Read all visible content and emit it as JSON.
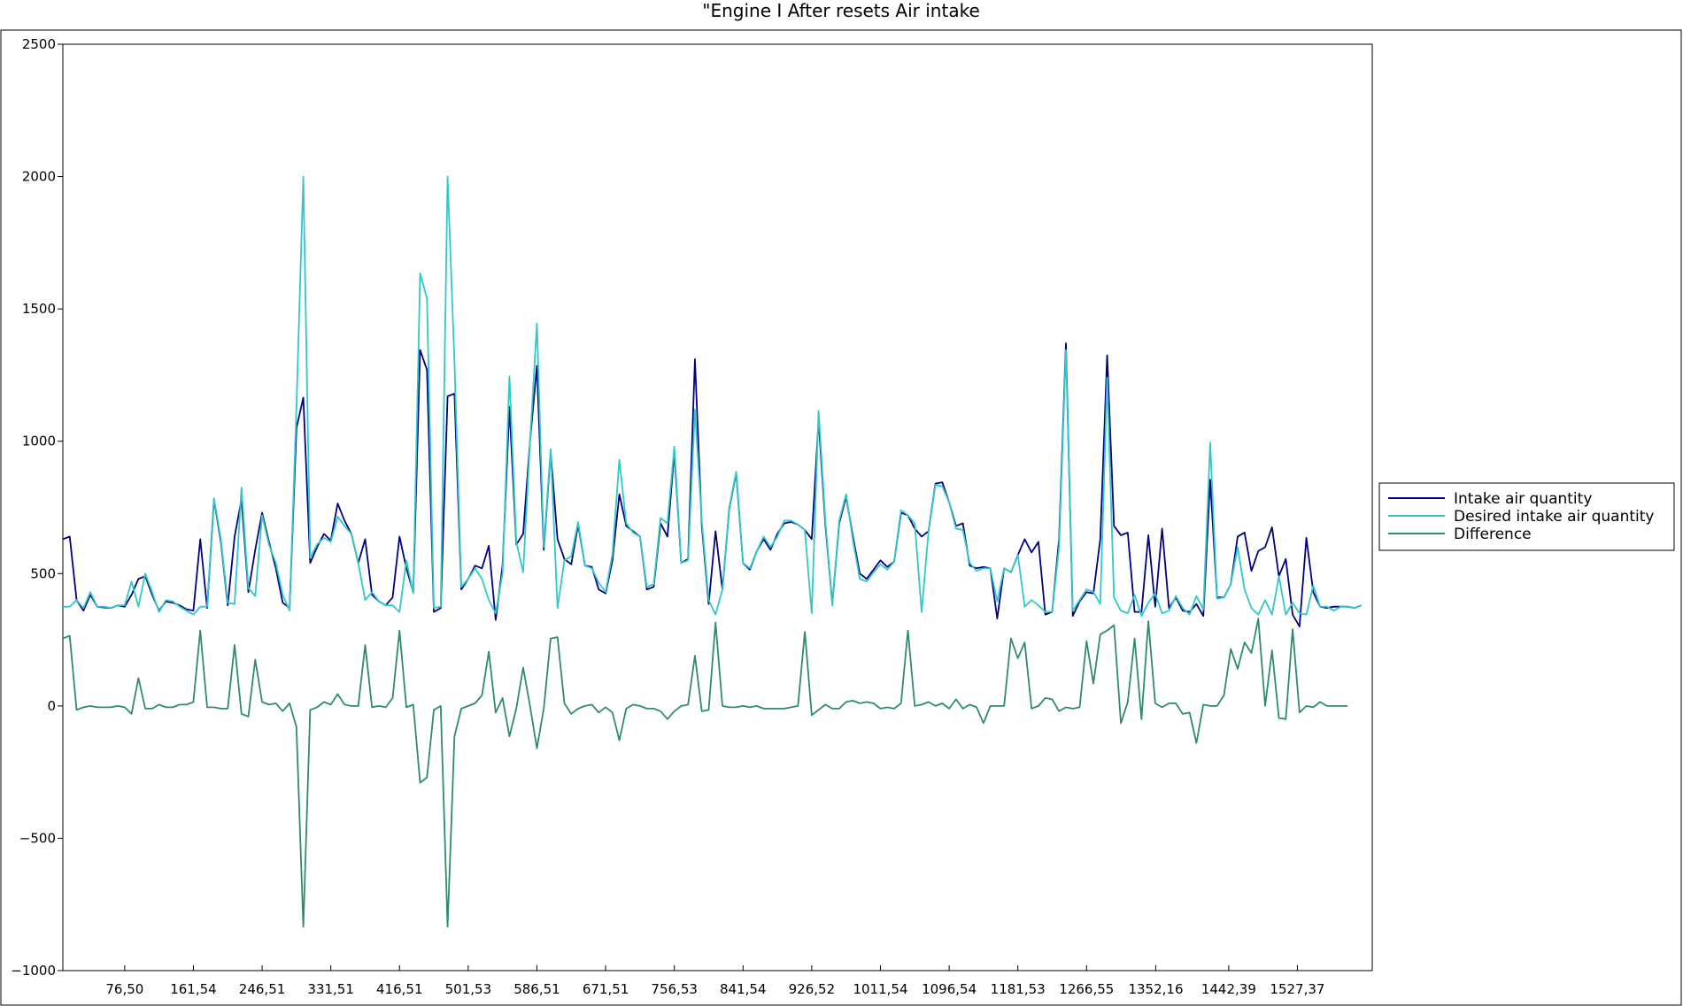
{
  "chart_data": {
    "type": "line",
    "title": "\"Engine I After resets Air intake",
    "xlabel": "",
    "ylabel": "",
    "ylim": [
      -1000,
      2500
    ],
    "yticks": [
      -1000,
      -500,
      0,
      500,
      1000,
      1500,
      2000,
      2500
    ],
    "ytick_labels": [
      "−1000",
      "−500",
      "0",
      "500",
      "1000",
      "1500",
      "2000",
      "2500"
    ],
    "xlim": [
      0,
      1620
    ],
    "xticks": [
      76.5,
      161.54,
      246.51,
      331.51,
      416.51,
      501.53,
      586.51,
      671.51,
      756.53,
      841.54,
      926.52,
      1011.54,
      1096.54,
      1181.53,
      1266.55,
      1352.16,
      1442.39,
      1527.37
    ],
    "xtick_labels": [
      "76,50",
      "161,54",
      "246,51",
      "331,51",
      "416,51",
      "501,53",
      "586,51",
      "671,51",
      "756,53",
      "841,54",
      "926,52",
      "1011,54",
      "1096,54",
      "1181,53",
      "1266,55",
      "1352,16",
      "1442,39",
      "1527,37"
    ],
    "grid": false,
    "legend_position": "right",
    "x": [
      0,
      8.5,
      17,
      25.5,
      34,
      42.5,
      51,
      59.5,
      68,
      76.5,
      85,
      93.5,
      102,
      110.5,
      119,
      127.5,
      136,
      144.5,
      153,
      161.5,
      170,
      178.5,
      187,
      195.5,
      204,
      212.5,
      221,
      229.5,
      238,
      246.5,
      255,
      263.5,
      272,
      280.5,
      289,
      297.5,
      306,
      314.5,
      323,
      331.5,
      340,
      348.5,
      357,
      365.5,
      374,
      382.5,
      391,
      399.5,
      408,
      416.5,
      425,
      433.5,
      442,
      450.5,
      459,
      467.5,
      476,
      484.5,
      493,
      501.5,
      510,
      518.5,
      527,
      535.5,
      544,
      552.5,
      561,
      569.5,
      578,
      586.5,
      595,
      603.5,
      612,
      620.5,
      629,
      637.5,
      646,
      654.5,
      663,
      671.5,
      680,
      688.5,
      697,
      705.5,
      714,
      722.5,
      731,
      739.5,
      748,
      756.5,
      765,
      773.5,
      782,
      790.5,
      799,
      807.5,
      816,
      824.5,
      833,
      841.5,
      850,
      858.5,
      867,
      875.5,
      884,
      892.5,
      901,
      909.5,
      918,
      926.5,
      935,
      943.5,
      952,
      960.5,
      969,
      977.5,
      986,
      994.5,
      1003,
      1011.5,
      1020,
      1028.5,
      1037,
      1045.5,
      1054,
      1062.5,
      1071,
      1079.5,
      1088,
      1096.5,
      1105,
      1113.5,
      1122,
      1130.5,
      1139,
      1147.5,
      1156,
      1164.5,
      1173,
      1181.5,
      1190,
      1198.5,
      1207,
      1215.5,
      1224,
      1232.5,
      1241,
      1249.5,
      1258,
      1266.5,
      1275,
      1283.5,
      1292,
      1300.5,
      1309,
      1317.5,
      1326,
      1334.5,
      1343,
      1351.5,
      1360,
      1368.5,
      1377,
      1385.5,
      1394,
      1402.5,
      1411,
      1419.5,
      1428,
      1436.5,
      1445,
      1453.5,
      1462,
      1470.5,
      1479,
      1487.5,
      1496,
      1504.5,
      1513,
      1521.5,
      1530,
      1538.5,
      1547,
      1555.5,
      1564,
      1572.5,
      1581,
      1589.5,
      1598,
      1606.5,
      1615,
      1620
    ],
    "series": [
      {
        "name": "Intake air quantity",
        "color": "#000080",
        "values": [
          630,
          640,
          400,
          360,
          420,
          375,
          372,
          370,
          380,
          375,
          420,
          480,
          490,
          420,
          360,
          395,
          390,
          380,
          365,
          360,
          630,
          370,
          780,
          620,
          380,
          640,
          780,
          430,
          590,
          730,
          620,
          520,
          390,
          370,
          1050,
          1165,
          540,
          600,
          650,
          625,
          765,
          700,
          650,
          540,
          630,
          420,
          395,
          380,
          410,
          640,
          520,
          430,
          1345,
          1270,
          355,
          370,
          1170,
          1180,
          440,
          480,
          530,
          520,
          605,
          325,
          530,
          1130,
          610,
          650,
          1000,
          1285,
          590,
          960,
          630,
          555,
          535,
          685,
          530,
          525,
          440,
          425,
          550,
          800,
          680,
          660,
          640,
          440,
          450,
          690,
          640,
          960,
          540,
          555,
          1310,
          680,
          385,
          660,
          440,
          745,
          880,
          540,
          515,
          585,
          630,
          590,
          650,
          690,
          695,
          685,
          665,
          630,
          1080,
          680,
          385,
          690,
          790,
          640,
          500,
          480,
          515,
          550,
          525,
          545,
          730,
          720,
          670,
          640,
          660,
          840,
          845,
          770,
          680,
          690,
          530,
          520,
          525,
          520,
          330,
          520,
          505,
          570,
          630,
          580,
          620,
          345,
          355,
          630,
          1370,
          340,
          395,
          430,
          425,
          630,
          1325,
          680,
          645,
          655,
          355,
          355,
          645,
          375,
          670,
          370,
          410,
          360,
          355,
          385,
          340,
          855,
          410,
          410,
          460,
          640,
          655,
          510,
          585,
          600,
          675,
          490,
          555,
          345,
          300,
          635,
          430,
          375,
          370,
          375,
          375,
          375,
          370,
          380
        ]
      },
      {
        "name": "Desired intake air quantity",
        "color": "#30c8c8",
        "values": [
          375,
          375,
          400,
          370,
          430,
          375,
          375,
          370,
          380,
          380,
          470,
          375,
          500,
          430,
          355,
          400,
          395,
          375,
          360,
          345,
          375,
          375,
          785,
          630,
          390,
          385,
          825,
          445,
          415,
          720,
          610,
          540,
          420,
          360,
          1130,
          2000,
          560,
          610,
          635,
          620,
          715,
          680,
          650,
          540,
          400,
          430,
          395,
          380,
          380,
          355,
          550,
          425,
          1635,
          1540,
          370,
          375,
          2000,
          1300,
          450,
          480,
          520,
          480,
          400,
          350,
          500,
          1245,
          620,
          505,
          1000,
          1445,
          600,
          970,
          370,
          550,
          565,
          695,
          530,
          520,
          465,
          430,
          575,
          930,
          690,
          655,
          640,
          450,
          460,
          710,
          690,
          980,
          540,
          550,
          1120,
          700,
          400,
          345,
          440,
          750,
          885,
          540,
          520,
          585,
          640,
          600,
          640,
          700,
          700,
          685,
          665,
          350,
          1115,
          695,
          380,
          700,
          800,
          625,
          480,
          470,
          505,
          535,
          515,
          545,
          740,
          720,
          690,
          355,
          660,
          835,
          830,
          770,
          670,
          665,
          540,
          510,
          520,
          520,
          395,
          520,
          505,
          570,
          375,
          400,
          380,
          355,
          355,
          600,
          1345,
          360,
          400,
          440,
          430,
          385,
          1240,
          410,
          360,
          350,
          420,
          340,
          390,
          425,
          350,
          360,
          415,
          370,
          345,
          415,
          365,
          995,
          405,
          410,
          460,
          600,
          440,
          370,
          345,
          400,
          345,
          490,
          345,
          390,
          350,
          345,
          455,
          375,
          375,
          360,
          375,
          375,
          370,
          380
        ]
      },
      {
        "name": "Difference",
        "color": "#2e8b6e",
        "values": [
          255,
          265,
          -15,
          -5,
          0,
          -5,
          -5,
          -5,
          0,
          -5,
          -30,
          105,
          -10,
          -10,
          5,
          -5,
          -5,
          5,
          5,
          15,
          285,
          -5,
          -5,
          -10,
          -10,
          230,
          -30,
          -40,
          175,
          15,
          5,
          10,
          -20,
          10,
          -80,
          -835,
          -15,
          -5,
          15,
          5,
          45,
          5,
          0,
          0,
          230,
          -5,
          0,
          -5,
          30,
          285,
          -5,
          5,
          -290,
          -270,
          -15,
          0,
          -835,
          -115,
          -10,
          0,
          10,
          40,
          205,
          -25,
          30,
          -115,
          -10,
          145,
          0,
          -160,
          -10,
          255,
          260,
          10,
          -30,
          -10,
          0,
          5,
          -25,
          -5,
          -25,
          -130,
          -10,
          5,
          0,
          -10,
          -10,
          -20,
          -50,
          -20,
          0,
          5,
          190,
          -20,
          -15,
          315,
          0,
          -5,
          -5,
          0,
          -5,
          0,
          -10,
          -10,
          -10,
          -10,
          -5,
          0,
          280,
          -35,
          -15,
          5,
          -10,
          -10,
          15,
          20,
          10,
          15,
          10,
          -10,
          -5,
          -10,
          10,
          285,
          0,
          5,
          15,
          0,
          10,
          -10,
          25,
          -10,
          5,
          -5,
          -65,
          0,
          0,
          0,
          255,
          180,
          240,
          -10,
          0,
          30,
          25,
          -20,
          -5,
          -10,
          -5,
          245,
          85,
          270,
          285,
          305,
          -65,
          15,
          255,
          -50,
          320,
          10,
          -5,
          10,
          10,
          -30,
          -25,
          -140,
          5,
          0,
          0,
          40,
          215,
          140,
          240,
          200,
          330,
          0,
          210,
          -45,
          -50,
          290,
          -25,
          0,
          -5,
          15,
          0,
          0,
          0,
          0
        ]
      }
    ]
  },
  "legend": {
    "items": [
      {
        "label": "Intake air quantity",
        "color": "#000080"
      },
      {
        "label": "Desired intake air quantity",
        "color": "#30c8c8"
      },
      {
        "label": "Difference",
        "color": "#2e8b6e"
      }
    ]
  }
}
